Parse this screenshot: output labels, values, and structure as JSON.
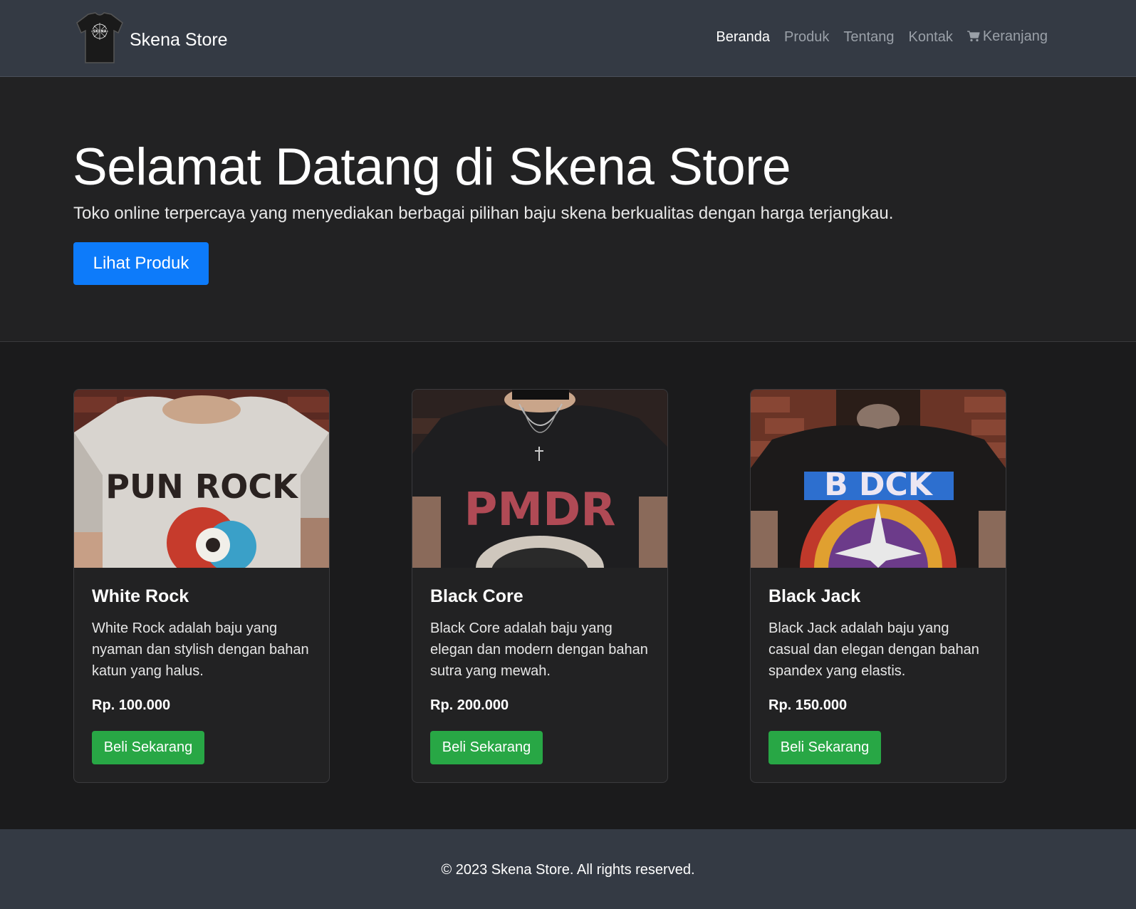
{
  "navbar": {
    "brand_name": "Skena Store",
    "logo_icon": "tshirt-logo-icon",
    "items": [
      {
        "label": "Beranda",
        "active": true
      },
      {
        "label": "Produk",
        "active": false
      },
      {
        "label": "Tentang",
        "active": false
      },
      {
        "label": "Kontak",
        "active": false
      },
      {
        "label": "Keranjang",
        "active": false,
        "icon": "cart-icon"
      }
    ]
  },
  "hero": {
    "title": "Selamat Datang di Skena Store",
    "lead": "Toko online terpercaya yang menyediakan berbagai pilihan baju skena berkualitas dengan harga terjangkau.",
    "button_label": "Lihat Produk"
  },
  "products": [
    {
      "name": "White Rock",
      "image_text": "PUN ROCK",
      "description": "White Rock adalah baju yang nyaman dan stylish dengan bahan katun yang halus.",
      "price": "Rp. 100.000",
      "button_label": "Beli Sekarang"
    },
    {
      "name": "Black Core",
      "image_text": "PMDR",
      "description": "Black Core adalah baju yang elegan dan modern dengan bahan sutra yang mewah.",
      "price": "Rp. 200.000",
      "button_label": "Beli Sekarang"
    },
    {
      "name": "Black Jack",
      "image_text": "B DCK",
      "description": "Black Jack adalah baju yang casual dan elegan dengan bahan spandex yang elastis.",
      "price": "Rp. 150.000",
      "button_label": "Beli Sekarang"
    }
  ],
  "footer": {
    "text": "© 2023 Skena Store. All rights reserved."
  },
  "colors": {
    "navbar_bg": "#343a44",
    "hero_bg": "#222223",
    "page_bg": "#1b1b1c",
    "primary": "#0d7bfa",
    "success": "#28a745"
  }
}
